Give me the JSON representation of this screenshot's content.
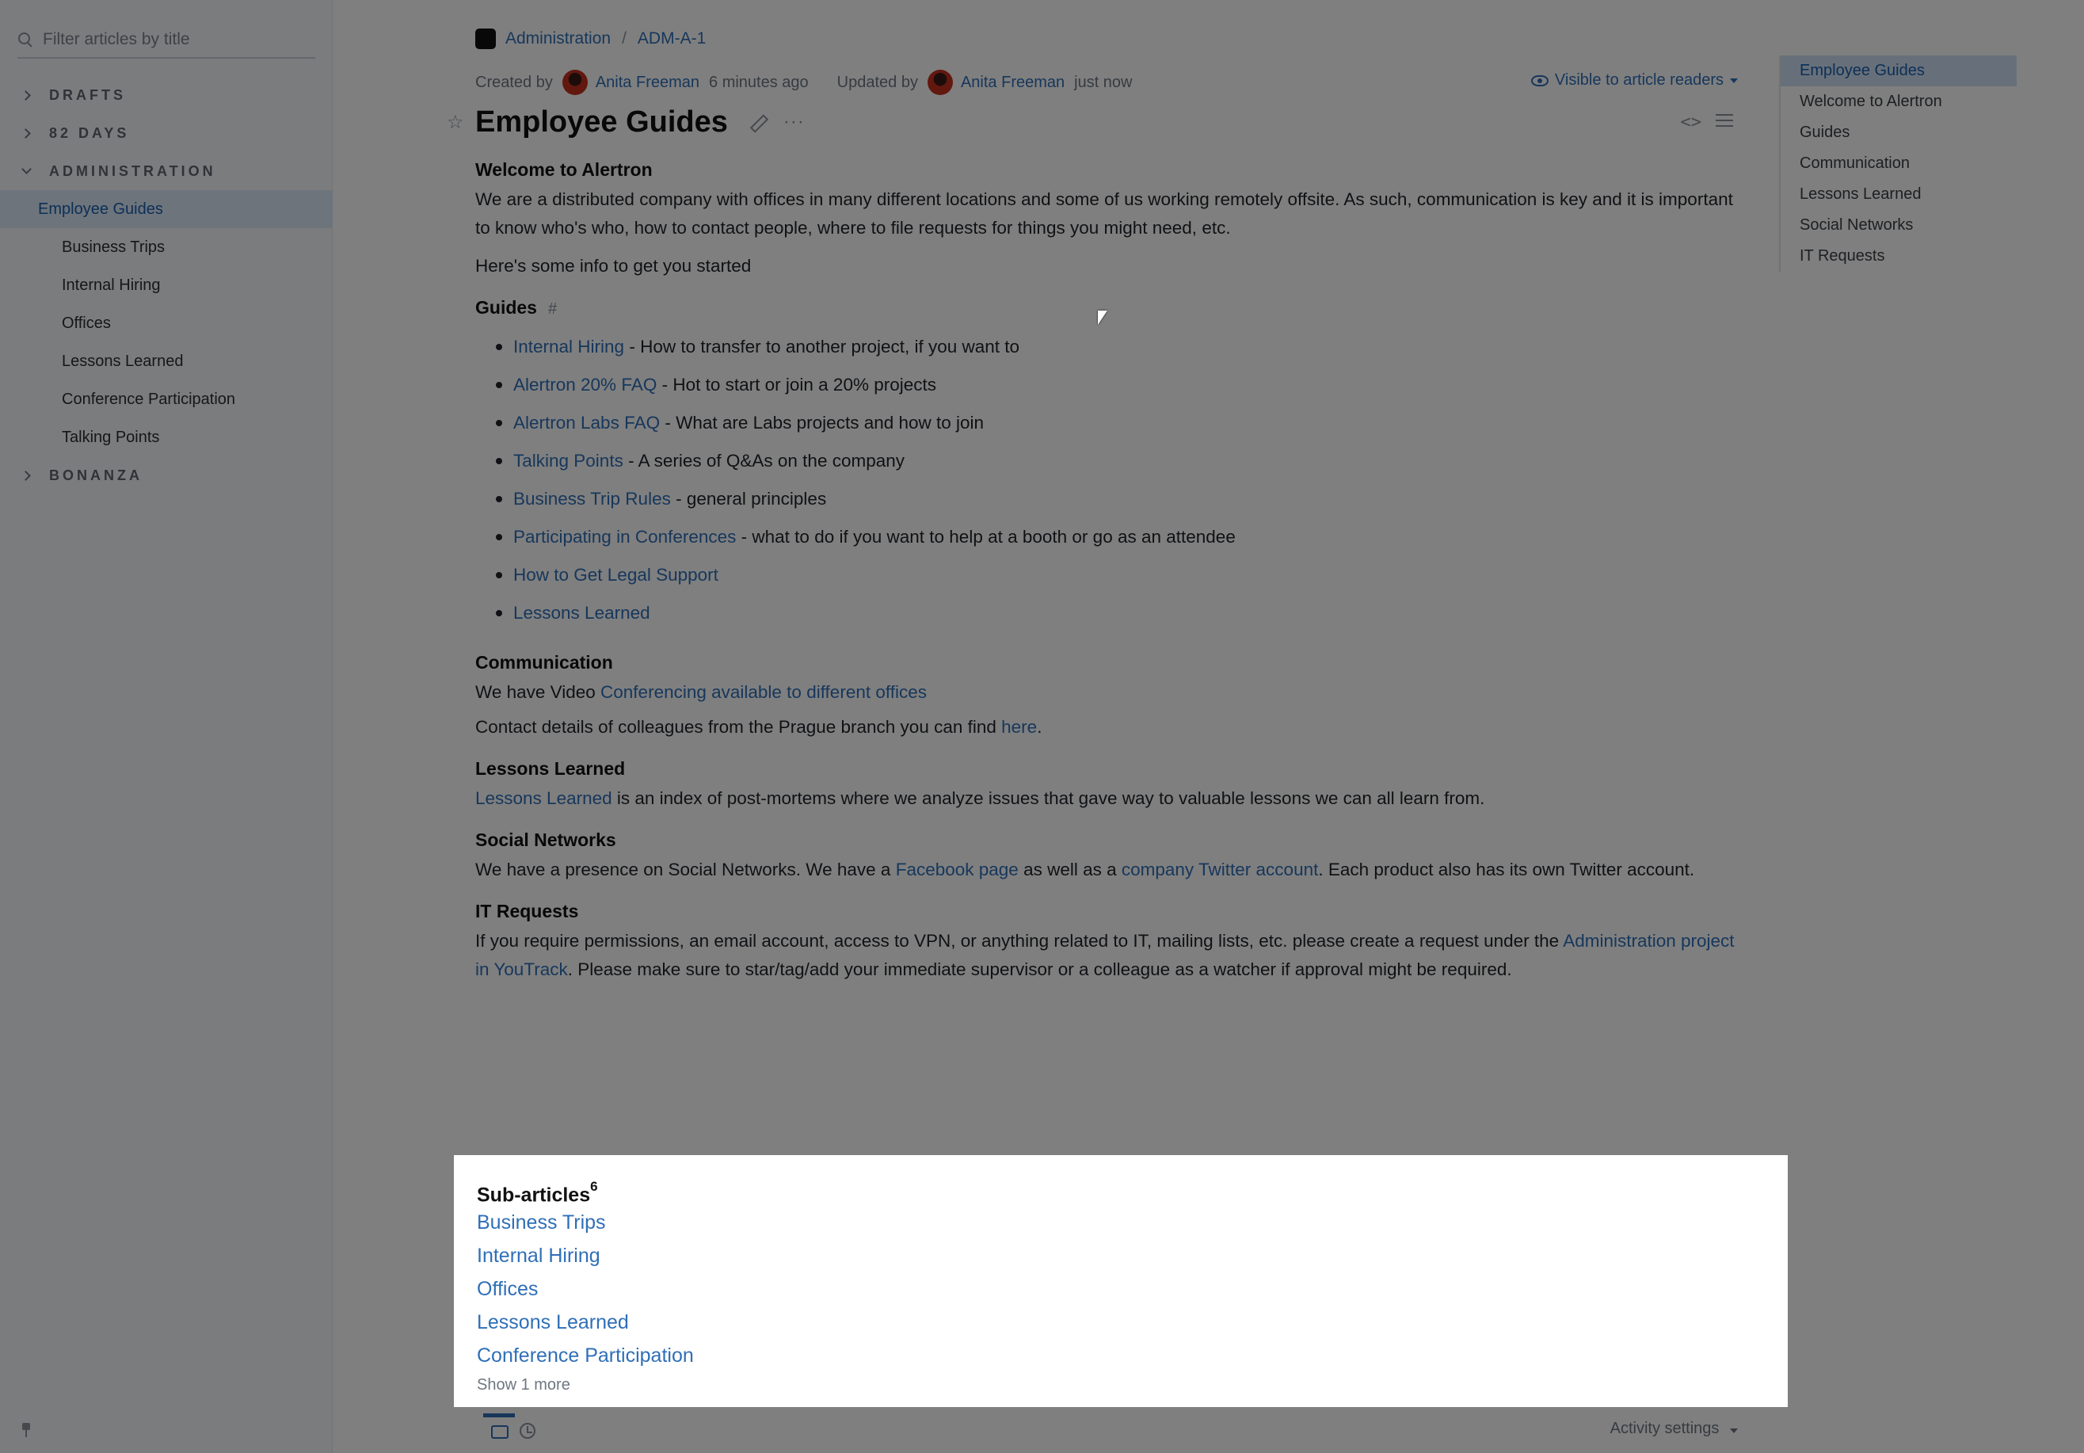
{
  "sidebar": {
    "filter_placeholder": "Filter articles by title",
    "sections": {
      "drafts": "DRAFTS",
      "days82": "82 DAYS",
      "administration": "ADMINISTRATION",
      "bonanza": "BONANZA"
    },
    "active_item": "Employee Guides",
    "children": [
      "Business Trips",
      "Internal Hiring",
      "Offices",
      "Lessons Learned",
      "Conference Participation",
      "Talking Points"
    ]
  },
  "breadcrumb": {
    "project": "Administration",
    "separator": "/",
    "article_id": "ADM-A-1"
  },
  "meta": {
    "created_label": "Created by",
    "created_author": "Anita Freeman",
    "created_time": "6 minutes ago",
    "updated_label": "Updated by",
    "updated_author": "Anita Freeman",
    "updated_time": "just now",
    "visibility": "Visible to article readers"
  },
  "article": {
    "title": "Employee Guides",
    "welcome_heading": "Welcome to Alertron",
    "welcome_text": "We are a distributed company with offices in many different locations and some of us working remotely offsite. As such, communication is key and it is important to know who's who, how to contact people, where to file requests for things you might need, etc.",
    "intro": "Here's some info to get you started",
    "guides_heading": "Guides",
    "anchor_symbol": "#",
    "guides": [
      {
        "link": "Internal Hiring",
        "desc": " - How to transfer to another project, if you want to"
      },
      {
        "link": "Alertron 20% FAQ",
        "desc": " - Hot to start or join a 20% projects"
      },
      {
        "link": "Alertron Labs FAQ",
        "desc": " - What are Labs projects and how to join"
      },
      {
        "link": "Talking Points",
        "desc": " - A series of Q&As on the company"
      },
      {
        "link": "Business Trip Rules",
        "desc": " - general principles"
      },
      {
        "link": "Participating in Conferences",
        "desc": " - what to do if you want to help at a booth or go as an attendee"
      },
      {
        "link": "How to Get Legal Support",
        "desc": ""
      },
      {
        "link": "Lessons Learned",
        "desc": ""
      }
    ],
    "communication_heading": "Communication",
    "communication_prefix": "We have Video ",
    "communication_link": "Conferencing available to different offices",
    "contact_prefix": "Contact details of colleagues from the Prague branch you can find ",
    "contact_link": "here",
    "contact_suffix": ".",
    "lessons_heading": "Lessons Learned",
    "lessons_link": "Lessons Learned",
    "lessons_text": " is an index of post-mortems where we analyze issues that gave way to valuable lessons we can all learn from.",
    "social_heading": "Social Networks",
    "social_prefix": "We have a presence on Social Networks. We have a ",
    "social_link1": "Facebook page",
    "social_mid": " as well as a ",
    "social_link2": "company Twitter account",
    "social_suffix": ". Each product also has its own Twitter account.",
    "it_heading": "IT Requests",
    "it_prefix": "If you require permissions, an email account, access to VPN, or anything related to IT, mailing lists, etc. please create a request under the ",
    "it_link": "Administration project in YouTrack",
    "it_suffix": ". Please make sure to star/tag/add your immediate supervisor or a colleague as a watcher if approval might be required."
  },
  "toc": [
    "Employee Guides",
    "Welcome to Alertron",
    "Guides",
    "Communication",
    "Lessons Learned",
    "Social Networks",
    "IT Requests"
  ],
  "subarticles": {
    "title": "Sub-articles",
    "count": "6",
    "items": [
      "Business Trips",
      "Internal Hiring",
      "Offices",
      "Lessons Learned",
      "Conference Participation"
    ],
    "show_more": "Show 1 more"
  },
  "footer": {
    "activity_settings": "Activity settings"
  },
  "colors": {
    "link": "#2f6fb7",
    "active_bg": "#dbe8f9",
    "overlay": "rgba(0,0,0,0.5)"
  }
}
